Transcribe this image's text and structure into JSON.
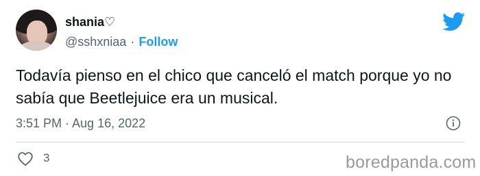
{
  "author": {
    "display_name": "shania♡",
    "handle": "@sshxniaa",
    "separator": "·",
    "follow_label": "Follow",
    "avatar_icon": "profile-photo",
    "follow_color": "#1d9bf0"
  },
  "brand": {
    "icon": "twitter-bird-icon",
    "color": "#1d9bf0"
  },
  "tweet": {
    "text": "Todavía pienso en el chico que canceló el match porque yo no sabía que Beetlejuice era un musical.",
    "timestamp": "3:51 PM · Aug 16, 2022",
    "info_icon": "info-icon"
  },
  "engagement": {
    "like_icon": "heart-icon",
    "like_count": "3"
  },
  "watermark": {
    "text": "boredpanda.com"
  }
}
